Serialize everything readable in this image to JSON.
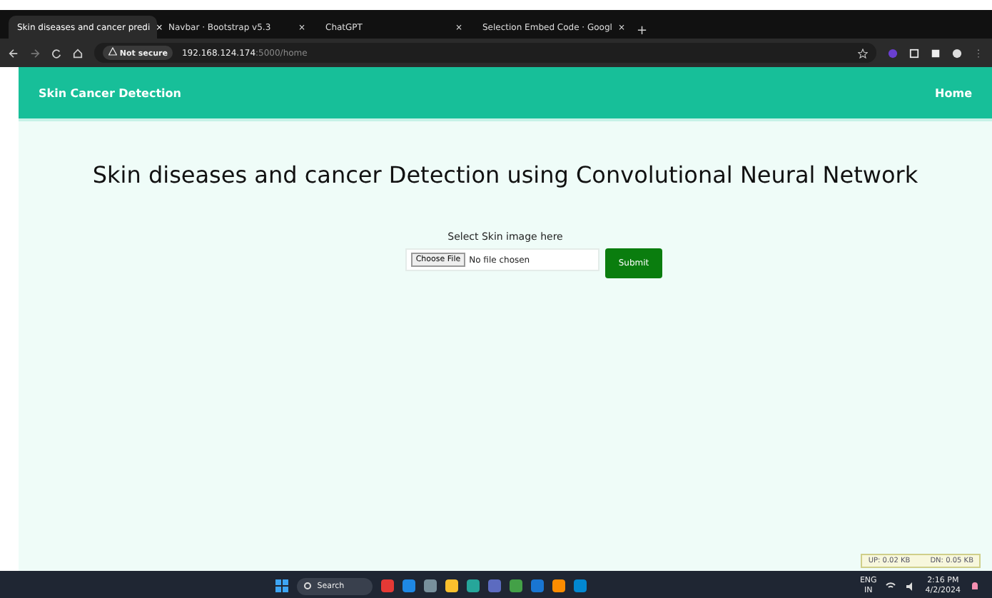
{
  "browser": {
    "tabs": [
      {
        "title": "Skin diseases and cancer predi",
        "selected": true,
        "close": "×"
      },
      {
        "title": "Navbar · Bootstrap v5.3",
        "selected": false,
        "close": "×"
      },
      {
        "title": "ChatGPT",
        "selected": false,
        "close": "×"
      },
      {
        "title": "Selection Embed Code · Googl",
        "selected": false,
        "close": "×"
      }
    ],
    "new_tab": "+",
    "security": "Not secure",
    "url_host": "192.168.124.174",
    "url_path": ":5000/home"
  },
  "navbar": {
    "brand": "Skin Cancer Detection",
    "links": [
      "Home"
    ]
  },
  "main": {
    "title": "Skin diseases and cancer Detection using Convolutional Neural Network",
    "form_label": "Select Skin image here",
    "file_button": "Choose File",
    "file_status": "No file chosen",
    "submit": "Submit"
  },
  "net_meter": {
    "up": "UP: 0.02 KB",
    "down": "DN: 0.05 KB"
  },
  "taskbar": {
    "search": "Search",
    "language": "ENG",
    "region": "IN",
    "time": "2:16 PM",
    "date": "4/2/2024"
  }
}
